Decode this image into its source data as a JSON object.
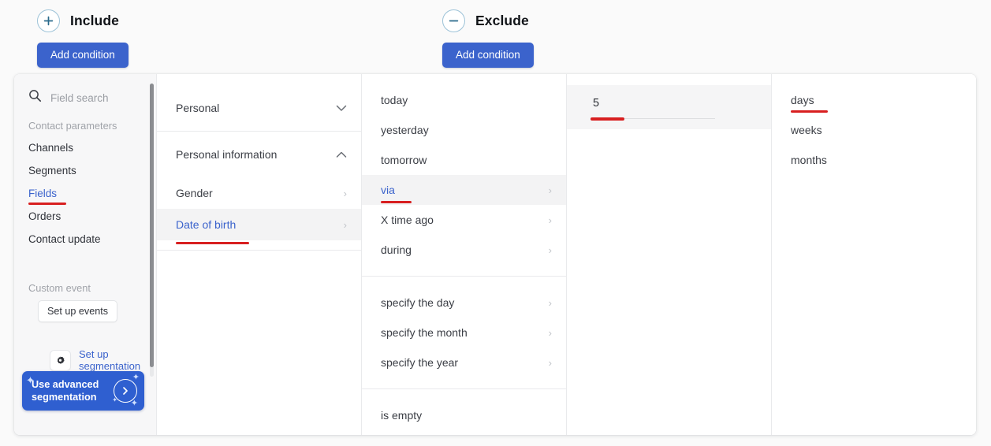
{
  "groups": {
    "include": {
      "icon": "plus-circle-icon",
      "title": "Include",
      "add_label": "Add condition"
    },
    "exclude": {
      "icon": "minus-circle-icon",
      "title": "Exclude",
      "add_label": "Add condition"
    }
  },
  "sidebar": {
    "search": {
      "icon": "search-icon",
      "placeholder": "Field search",
      "value": ""
    },
    "section_label": "Contact parameters",
    "items": [
      {
        "label": "Channels",
        "active": false
      },
      {
        "label": "Segments",
        "active": false
      },
      {
        "label": "Fields",
        "active": true
      },
      {
        "label": "Orders",
        "active": false
      },
      {
        "label": "Contact update",
        "active": false
      }
    ],
    "custom_event_label": "Custom event",
    "set_up_events_label": "Set up events",
    "set_up_segmentation": {
      "icon": "gear-icon",
      "label": "Set up segmentation"
    },
    "advanced": {
      "label": "Use advanced segmentation",
      "icon": "chevron-right-circle-icon"
    }
  },
  "groups_column": {
    "rows": [
      {
        "label": "Personal",
        "caret": "chevron-down-icon",
        "selected": false
      },
      {
        "label": "Personal information",
        "caret": "chevron-up-icon",
        "selected": false
      },
      {
        "label": "Gender",
        "chevron": "chevron-right-icon",
        "selected": false
      },
      {
        "label": "Date of birth",
        "chevron": "chevron-right-icon",
        "selected": true
      }
    ]
  },
  "options_column": {
    "group_one": [
      {
        "label": "today",
        "chevron": false,
        "selected": false
      },
      {
        "label": "yesterday",
        "chevron": false,
        "selected": false
      },
      {
        "label": "tomorrow",
        "chevron": false,
        "selected": false
      },
      {
        "label": "via",
        "chevron": true,
        "selected": true
      },
      {
        "label": "X time ago",
        "chevron": true,
        "selected": false
      },
      {
        "label": "during",
        "chevron": true,
        "selected": false
      }
    ],
    "group_two": [
      {
        "label": "specify the day",
        "chevron": true,
        "selected": false
      },
      {
        "label": "specify the month",
        "chevron": true,
        "selected": false
      },
      {
        "label": "specify the year",
        "chevron": true,
        "selected": false
      }
    ],
    "group_three": [
      {
        "label": "is empty",
        "chevron": false,
        "selected": false
      }
    ]
  },
  "value_column": {
    "value": "5"
  },
  "unit_column": {
    "rows": [
      {
        "label": "days",
        "selected": true
      },
      {
        "label": "weeks",
        "selected": false
      },
      {
        "label": "months",
        "selected": false
      }
    ]
  },
  "colors": {
    "accent_blue": "#3b63cc",
    "annotation_red": "#d81f20",
    "sidebar_bg": "#f7f7f8",
    "selected_row_bg": "#f3f3f4"
  }
}
